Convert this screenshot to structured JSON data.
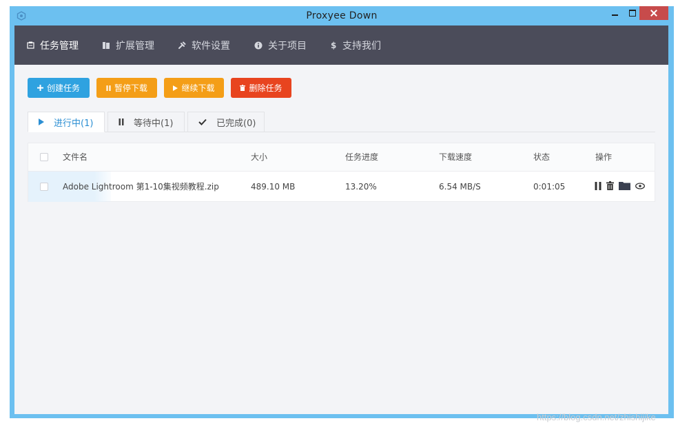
{
  "window": {
    "title": "Proxyee Down"
  },
  "nav": [
    {
      "label": "任务管理",
      "icon": "task-icon"
    },
    {
      "label": "扩展管理",
      "icon": "extension-icon"
    },
    {
      "label": "软件设置",
      "icon": "settings-icon"
    },
    {
      "label": "关于项目",
      "icon": "info-icon"
    },
    {
      "label": "支持我们",
      "icon": "dollar-icon"
    }
  ],
  "actions": {
    "create": "创建任务",
    "pause": "暂停下载",
    "resume": "继续下载",
    "delete": "删除任务"
  },
  "tabs": [
    {
      "label": "进行中(1)",
      "icon": "play-icon"
    },
    {
      "label": "等待中(1)",
      "icon": "pause-icon"
    },
    {
      "label": "已完成(0)",
      "icon": "check-icon"
    }
  ],
  "table": {
    "columns": [
      "文件名",
      "大小",
      "任务进度",
      "下载速度",
      "状态",
      "操作"
    ],
    "rows": [
      {
        "name": "Adobe Lightroom 第1-10集视频教程.zip",
        "size": "489.10 MB",
        "progress": "13.20%",
        "speed": "6.54 MB/S",
        "status": "0:01:05"
      }
    ]
  },
  "watermark": "https://blog.csdn.net/zhishijike",
  "colors": {
    "window_frame": "#6cc0f0",
    "navbar": "#4b4c5a",
    "primary": "#2fa2e0",
    "warning": "#f49e17",
    "danger": "#e8441f",
    "close_button": "#c74b4b"
  }
}
